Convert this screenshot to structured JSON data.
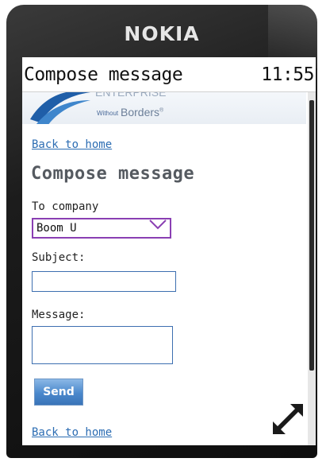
{
  "device": {
    "brand": "NOKIA"
  },
  "titlebar": {
    "title": "Compose message",
    "clock": "11:55"
  },
  "banner": {
    "tag_top": "ENTERPRISE",
    "tag_small": "Without",
    "tag_big": "Borders",
    "trademark": "®"
  },
  "nav": {
    "back_top": "Back to home",
    "back_bottom": "Back to home"
  },
  "form": {
    "heading": "Compose message",
    "to_company_label": "To company",
    "to_company_value": "Boom U",
    "subject_label": "Subject:",
    "subject_value": "",
    "message_label": "Message:",
    "message_value": "",
    "send_label": "Send"
  },
  "colors": {
    "link": "#2c6db3",
    "select_border": "#8a3fb3",
    "send": "#4a88cc"
  },
  "icons": [
    "logo-swoosh-icon",
    "chevron-down-icon",
    "resize-arrows-icon"
  ]
}
